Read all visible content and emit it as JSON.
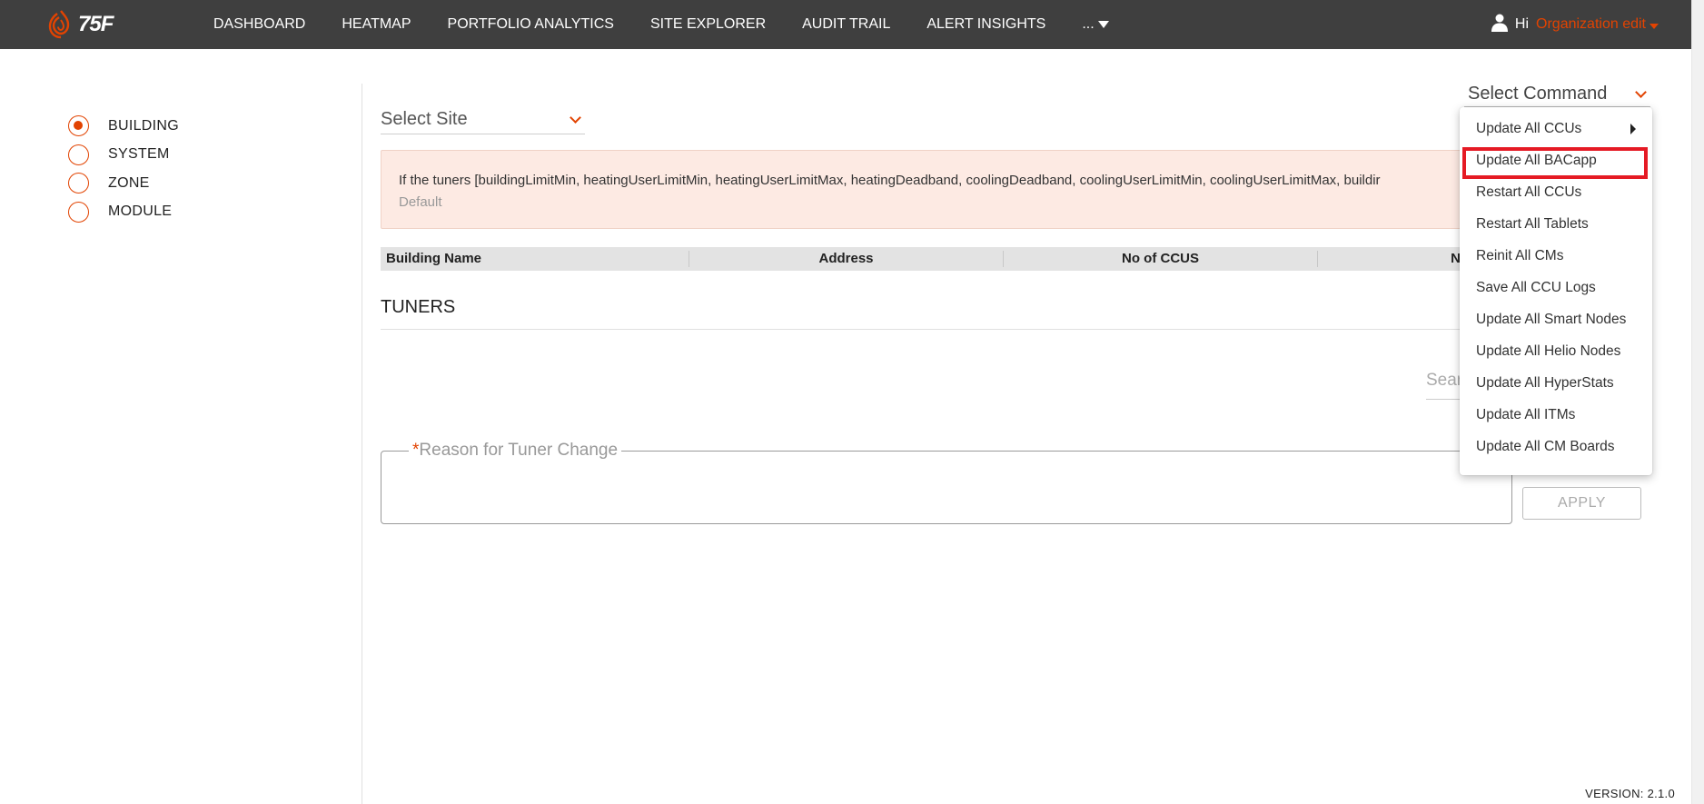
{
  "brand": {
    "logo_text": "75F",
    "accent": "#e24301"
  },
  "nav": {
    "items": [
      "DASHBOARD",
      "HEATMAP",
      "PORTFOLIO ANALYTICS",
      "SITE EXPLORER",
      "AUDIT TRAIL",
      "ALERT INSIGHTS"
    ],
    "more_label": "..."
  },
  "user": {
    "greeting": "Hi",
    "org_name": "Organization edit"
  },
  "levels": {
    "options": [
      "BUILDING",
      "SYSTEM",
      "ZONE",
      "MODULE"
    ],
    "selected": "BUILDING"
  },
  "site_select": {
    "placeholder": "Select Site"
  },
  "command_select": {
    "placeholder": "Select Command",
    "menu_items": [
      "Update All CCUs",
      "Update All BACapp",
      "Restart All CCUs",
      "Restart All Tablets",
      "Reinit All CMs",
      "Save All CCU Logs",
      "Update All Smart Nodes",
      "Update All Helio Nodes",
      "Update All HyperStats",
      "Update All ITMs",
      "Update All CM Boards"
    ],
    "highlighted": "Update All BACapp"
  },
  "alert": {
    "text": "If the tuners [buildingLimitMin, heatingUserLimitMin, heatingUserLimitMax, heatingDeadband, coolingDeadband, coolingUserLimitMin, coolingUserLimitMax, buildir",
    "subtext": "Default"
  },
  "table": {
    "headers": [
      "Building Name",
      "Address",
      "No of CCUS",
      "N"
    ]
  },
  "tuners": {
    "title": "TUNERS",
    "search_placeholder": "Sear"
  },
  "reason": {
    "required_mark": "*",
    "label": "Reason for Tuner Change"
  },
  "apply_label": "APPLY",
  "version": "VERSION: 2.1.0"
}
